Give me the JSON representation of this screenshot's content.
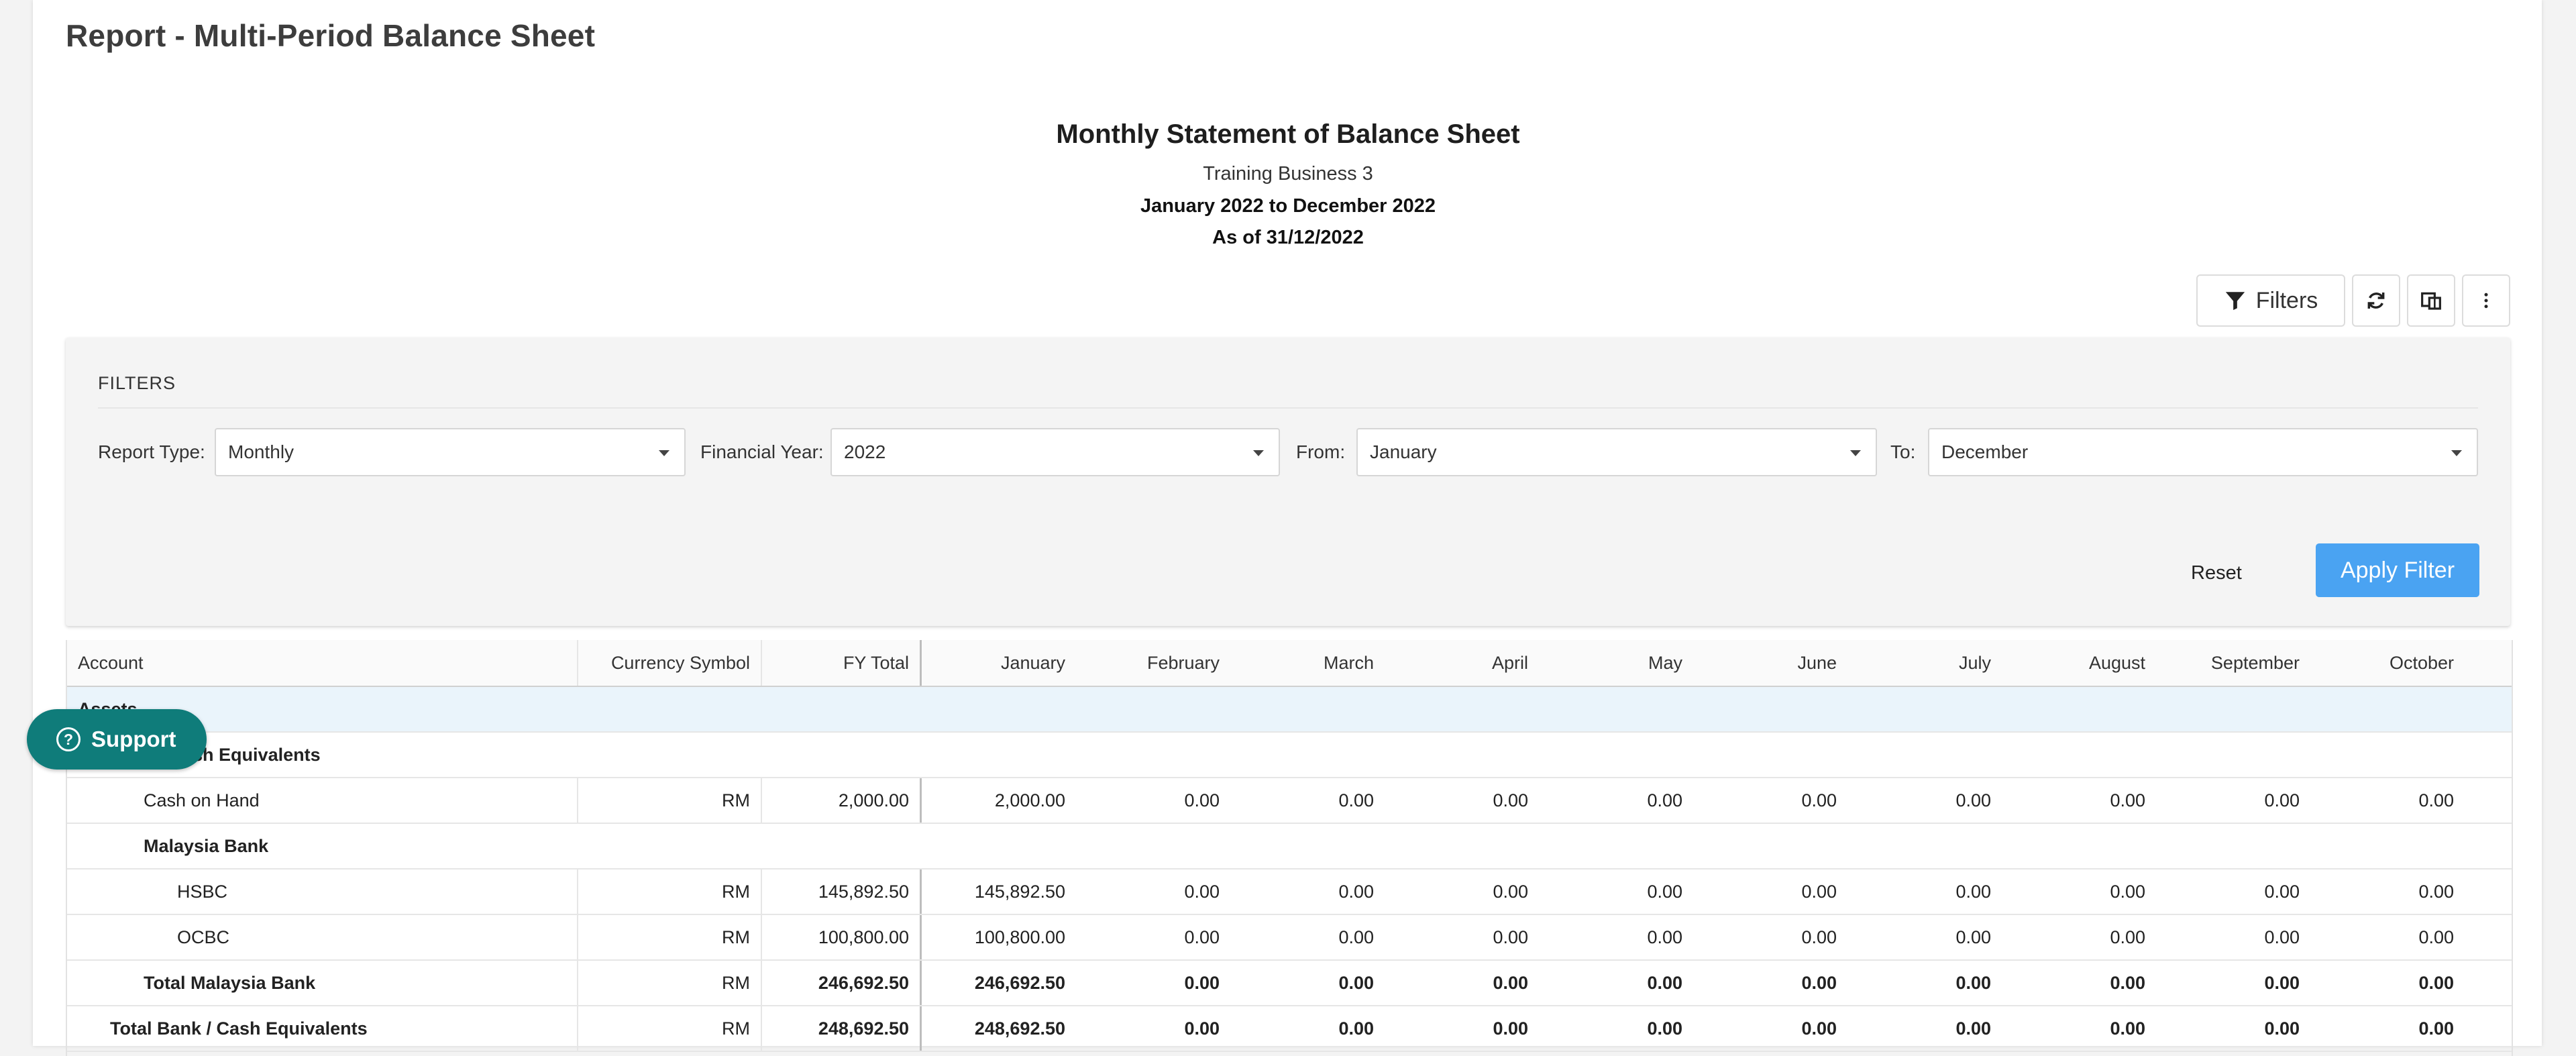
{
  "page_title": "Report - Multi-Period Balance Sheet",
  "report_header": {
    "title": "Monthly Statement of Balance Sheet",
    "business": "Training Business 3",
    "period": "January 2022 to December 2022",
    "as_of": "As of 31/12/2022"
  },
  "toolbar": {
    "filters_label": "Filters",
    "icons": [
      "filter-icon",
      "refresh-icon",
      "columns-toggle-icon",
      "more-vertical-icon"
    ]
  },
  "filters": {
    "heading": "FILTERS",
    "report_type": {
      "label": "Report Type:",
      "value": "Monthly"
    },
    "financial_year": {
      "label": "Financial Year:",
      "value": "2022"
    },
    "from": {
      "label": "From:",
      "value": "January"
    },
    "to": {
      "label": "To:",
      "value": "December"
    },
    "reset_label": "Reset",
    "apply_label": "Apply Filter"
  },
  "table": {
    "columns": [
      "Account",
      "Currency Symbol",
      "FY Total",
      "January",
      "February",
      "March",
      "April",
      "May",
      "June",
      "July",
      "August",
      "September",
      "October"
    ],
    "rows": [
      {
        "type": "section",
        "account": "Assets",
        "cells": []
      },
      {
        "type": "group",
        "account": "Bank / Cash Equivalents",
        "cells": []
      },
      {
        "type": "item",
        "level": 2,
        "account": "Cash on Hand",
        "cells": [
          "RM",
          "2,000.00",
          "2,000.00",
          "0.00",
          "0.00",
          "0.00",
          "0.00",
          "0.00",
          "0.00",
          "0.00",
          "0.00",
          "0.00"
        ]
      },
      {
        "type": "group2",
        "account": "Malaysia Bank",
        "cells": []
      },
      {
        "type": "item",
        "level": 3,
        "account": "HSBC",
        "cells": [
          "RM",
          "145,892.50",
          "145,892.50",
          "0.00",
          "0.00",
          "0.00",
          "0.00",
          "0.00",
          "0.00",
          "0.00",
          "0.00",
          "0.00"
        ]
      },
      {
        "type": "item",
        "level": 3,
        "account": "OCBC",
        "cells": [
          "RM",
          "100,800.00",
          "100,800.00",
          "0.00",
          "0.00",
          "0.00",
          "0.00",
          "0.00",
          "0.00",
          "0.00",
          "0.00",
          "0.00"
        ]
      },
      {
        "type": "total",
        "level": 2,
        "account": "Total Malaysia Bank",
        "cells": [
          "RM",
          "246,692.50",
          "246,692.50",
          "0.00",
          "0.00",
          "0.00",
          "0.00",
          "0.00",
          "0.00",
          "0.00",
          "0.00",
          "0.00"
        ]
      },
      {
        "type": "total",
        "level": 1,
        "account": "Total Bank / Cash Equivalents",
        "cells": [
          "RM",
          "248,692.50",
          "248,692.50",
          "0.00",
          "0.00",
          "0.00",
          "0.00",
          "0.00",
          "0.00",
          "0.00",
          "0.00",
          "0.00"
        ]
      }
    ]
  },
  "support": {
    "label": "Support",
    "icon": "help-circle-icon"
  },
  "colors": {
    "accent": "#4aa3f2",
    "support": "#0f7c7a",
    "section_bg": "#eaf4fb"
  }
}
